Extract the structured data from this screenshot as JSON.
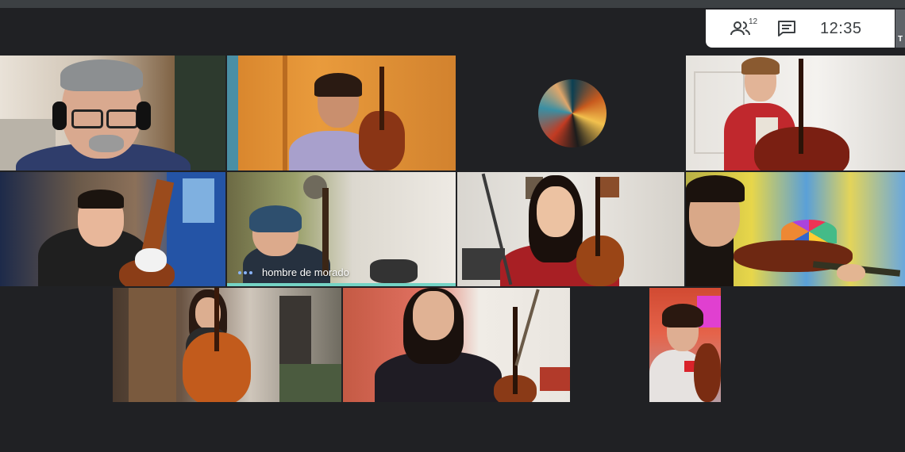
{
  "toolbar": {
    "participants_count": "12",
    "clock": "12:35",
    "self_tile_initial": "T"
  },
  "tiles": [
    {
      "id": "teacher",
      "name": ""
    },
    {
      "id": "cello-girl-orange",
      "name": ""
    },
    {
      "id": "avatar",
      "name": ""
    },
    {
      "id": "double-bass-girl",
      "name": ""
    },
    {
      "id": "boy-old-navy",
      "name": ""
    },
    {
      "id": "hombre-de-morado",
      "name": "hombre de morado"
    },
    {
      "id": "violin-girl-smiling",
      "name": ""
    },
    {
      "id": "violin-girl-glasses",
      "name": ""
    },
    {
      "id": "cello-girl-room",
      "name": ""
    },
    {
      "id": "violin-girl-dark",
      "name": ""
    },
    {
      "id": "small-girl-minnie",
      "name": ""
    }
  ],
  "colors": {
    "background": "#202124",
    "active_speaker": "#74d3c5",
    "speaking_dots": "#8ab4f8"
  },
  "icons": {
    "people": "people-icon",
    "chat": "chat-icon"
  }
}
